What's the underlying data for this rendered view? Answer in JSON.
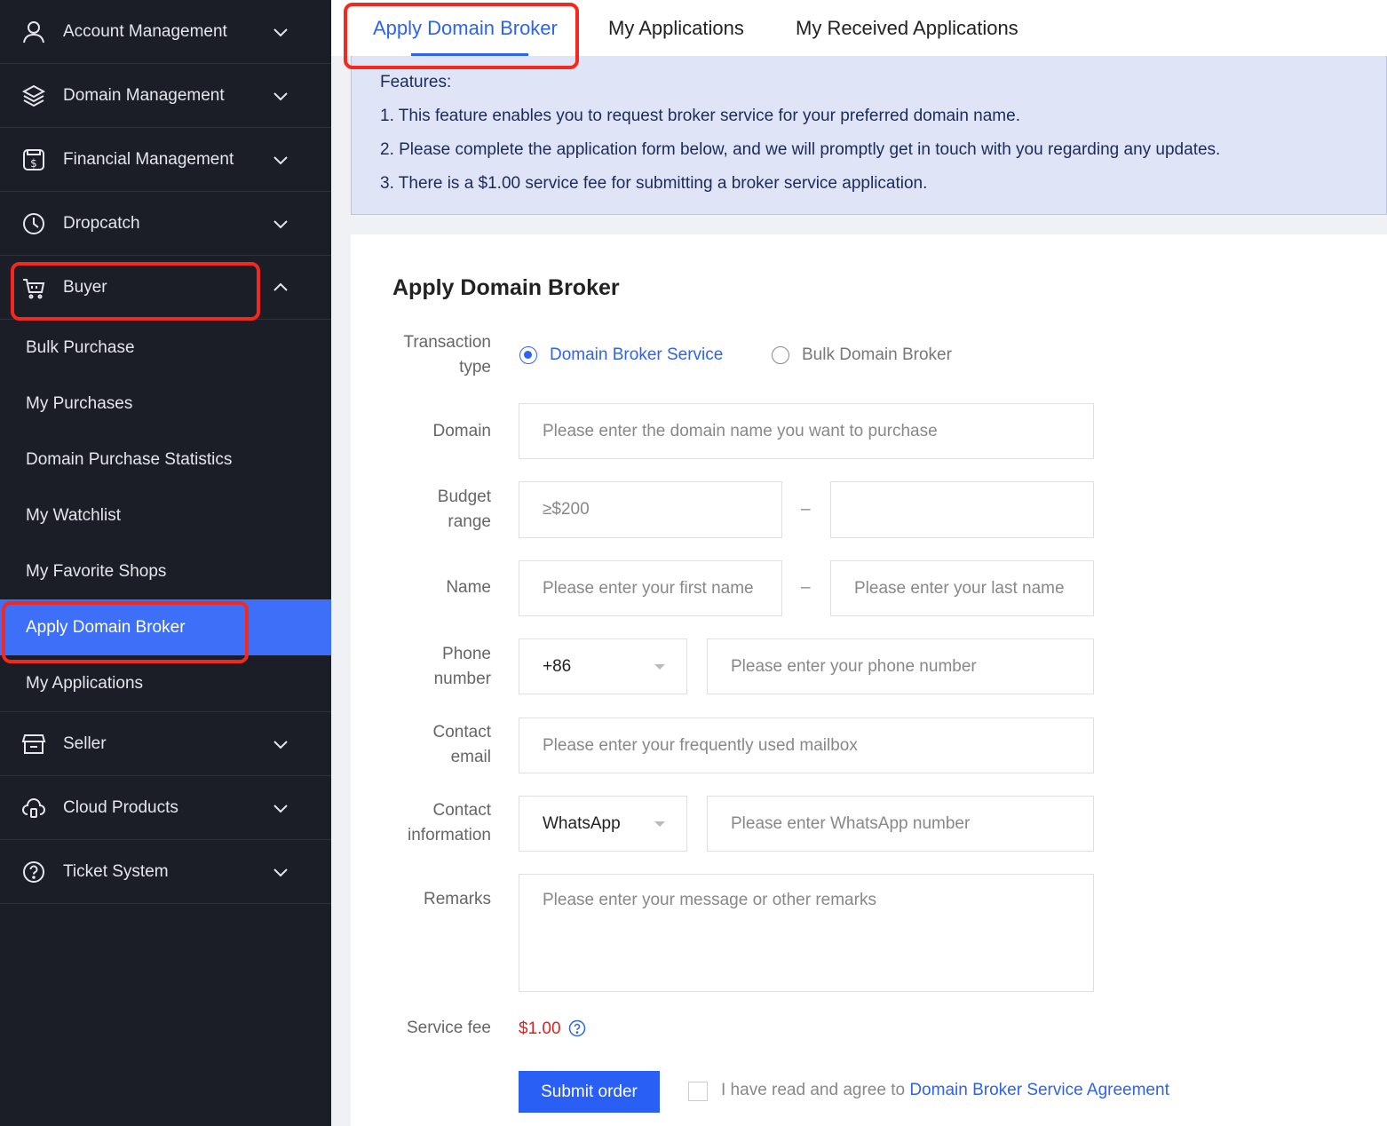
{
  "sidebar": {
    "groups": [
      {
        "label": "Account Management",
        "icon": "user-icon"
      },
      {
        "label": "Domain Management",
        "icon": "layers-icon"
      },
      {
        "label": "Financial Management",
        "icon": "dollar-icon"
      },
      {
        "label": "Dropcatch",
        "icon": "clock-icon"
      },
      {
        "label": "Buyer",
        "icon": "cart-icon",
        "expanded": true
      },
      {
        "label": "Seller",
        "icon": "store-icon"
      },
      {
        "label": "Cloud Products",
        "icon": "cloud-icon"
      },
      {
        "label": "Ticket System",
        "icon": "help-icon"
      }
    ],
    "buyer_items": [
      {
        "label": "Bulk Purchase"
      },
      {
        "label": "My Purchases"
      },
      {
        "label": "Domain Purchase Statistics"
      },
      {
        "label": "My Watchlist"
      },
      {
        "label": "My Favorite Shops"
      },
      {
        "label": "Apply Domain Broker",
        "active": true
      },
      {
        "label": "My Applications"
      }
    ]
  },
  "tabs": [
    {
      "label": "Apply Domain Broker",
      "active": true
    },
    {
      "label": "My Applications"
    },
    {
      "label": "My Received Applications"
    }
  ],
  "features": {
    "heading": "Features:",
    "lines": [
      "1. This feature enables you to request broker service for your preferred domain name.",
      "2. Please complete the application form below, and we will promptly get in touch with you regarding any updates.",
      "3. There is a $1.00 service fee for submitting a broker service application."
    ]
  },
  "form": {
    "title": "Apply Domain Broker",
    "transaction_type": {
      "label_line1": "Transaction",
      "label_line2": "type",
      "options": [
        "Domain Broker Service",
        "Bulk Domain Broker"
      ],
      "selected": "Domain Broker Service"
    },
    "domain": {
      "label": "Domain",
      "placeholder": "Please enter the domain name you want to purchase"
    },
    "budget": {
      "label_line1": "Budget",
      "label_line2": "range",
      "min_placeholder": "≥$200",
      "max_placeholder": "",
      "separator": "–"
    },
    "name": {
      "label": "Name",
      "first_placeholder": "Please enter your first name",
      "last_placeholder": "Please enter your last name",
      "separator": "–"
    },
    "phone": {
      "label_line1": "Phone",
      "label_line2": "number",
      "code": "+86",
      "placeholder": "Please enter your phone number"
    },
    "email": {
      "label_line1": "Contact",
      "label_line2": "email",
      "placeholder": "Please enter your frequently used mailbox"
    },
    "contact": {
      "label_line1": "Contact",
      "label_line2": "information",
      "method": "WhatsApp",
      "placeholder": "Please enter WhatsApp number"
    },
    "remarks": {
      "label": "Remarks",
      "placeholder": "Please enter your message or other remarks"
    },
    "service_fee": {
      "label": "Service fee",
      "value": "$1.00"
    },
    "submit_label": "Submit order",
    "agree_text": "I have read and agree to ",
    "agree_link": "Domain Broker Service Agreement"
  },
  "colors": {
    "accent": "#2e62f0",
    "sidebar_bg": "#1b1e27",
    "highlight": "#f5281e",
    "fee": "#e02020"
  }
}
